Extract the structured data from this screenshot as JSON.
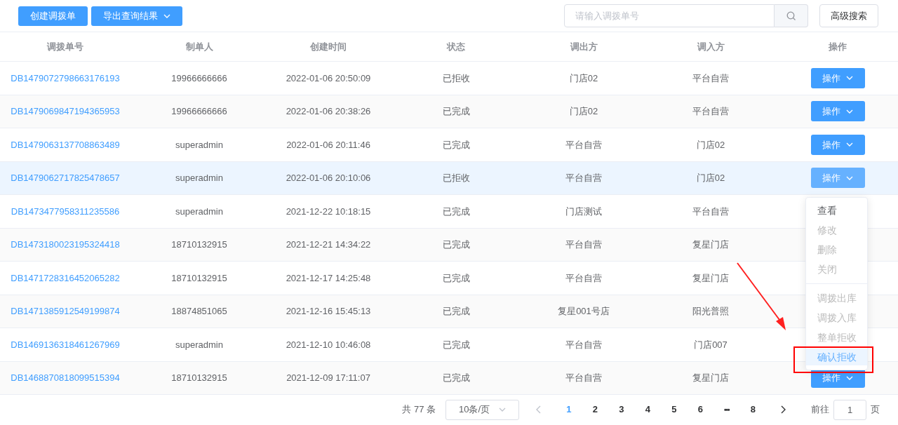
{
  "toolbar": {
    "buttons": [
      {
        "label": "创建调拨单",
        "dropdown": false
      },
      {
        "label": "导出查询结果",
        "dropdown": true
      }
    ],
    "search": {
      "placeholder": "请输入调拨单号"
    },
    "advanced_search": "高级搜索"
  },
  "table": {
    "columns": [
      "调拨单号",
      "制单人",
      "创建时间",
      "状态",
      "调出方",
      "调入方",
      "操作"
    ],
    "rows": [
      {
        "id": "DB1479072798663176193",
        "creator": "19966666666",
        "created": "2022-01-06 20:50:09",
        "status": "已拒收",
        "from": "门店02",
        "to": "平台自营",
        "action": "操作",
        "highlighted": false
      },
      {
        "id": "DB1479069847194365953",
        "creator": "19966666666",
        "created": "2022-01-06 20:38:26",
        "status": "已完成",
        "from": "门店02",
        "to": "平台自营",
        "action": "操作",
        "highlighted": false
      },
      {
        "id": "DB1479063137708863489",
        "creator": "superadmin",
        "created": "2022-01-06 20:11:46",
        "status": "已完成",
        "from": "平台自营",
        "to": "门店02",
        "action": "操作",
        "highlighted": false
      },
      {
        "id": "DB1479062717825478657",
        "creator": "superadmin",
        "created": "2022-01-06 20:10:06",
        "status": "已拒收",
        "from": "平台自营",
        "to": "门店02",
        "action": "操作",
        "highlighted": true
      },
      {
        "id": "DB1473477958311235586",
        "creator": "superadmin",
        "created": "2021-12-22 10:18:15",
        "status": "已完成",
        "from": "门店测试",
        "to": "平台自营",
        "highlighted": false
      },
      {
        "id": "DB1473180023195324418",
        "creator": "18710132915",
        "created": "2021-12-21 14:34:22",
        "status": "已完成",
        "from": "平台自营",
        "to": "复星门店",
        "highlighted": false
      },
      {
        "id": "DB1471728316452065282",
        "creator": "18710132915",
        "created": "2021-12-17 14:25:48",
        "status": "已完成",
        "from": "平台自营",
        "to": "复星门店",
        "highlighted": false
      },
      {
        "id": "DB1471385912549199874",
        "creator": "18874851065",
        "created": "2021-12-16 15:45:13",
        "status": "已完成",
        "from": "复星001号店",
        "to": "阳光普照",
        "highlighted": false
      },
      {
        "id": "DB1469136318461267969",
        "creator": "superadmin",
        "created": "2021-12-10 10:46:08",
        "status": "已完成",
        "from": "平台自营",
        "to": "门店007",
        "highlighted": false
      },
      {
        "id": "DB1468870818099515394",
        "creator": "18710132915",
        "created": "2021-12-09 17:11:07",
        "status": "已完成",
        "from": "平台自营",
        "to": "复星门店",
        "action": "操作",
        "highlighted": false
      }
    ]
  },
  "action_menu": {
    "groups": [
      [
        {
          "label": "查看",
          "disabled": false,
          "selected": false
        },
        {
          "label": "修改",
          "disabled": true,
          "selected": false
        },
        {
          "label": "删除",
          "disabled": true,
          "selected": false
        },
        {
          "label": "关闭",
          "disabled": true,
          "selected": false
        }
      ],
      [
        {
          "label": "调拨出库",
          "disabled": true,
          "selected": false
        },
        {
          "label": "调拨入库",
          "disabled": true,
          "selected": false
        },
        {
          "label": "整单拒收",
          "disabled": true,
          "selected": false
        },
        {
          "label": "确认拒收",
          "disabled": false,
          "selected": true
        }
      ]
    ]
  },
  "pagination": {
    "total": "共 77 条",
    "page_size": "10条/页",
    "pages": [
      {
        "label": "1",
        "kind": "page",
        "selected": true
      },
      {
        "label": "2",
        "kind": "page",
        "selected": false
      },
      {
        "label": "3",
        "kind": "page",
        "selected": false
      },
      {
        "label": "4",
        "kind": "page",
        "selected": false
      },
      {
        "label": "5",
        "kind": "page",
        "selected": false
      },
      {
        "label": "6",
        "kind": "page",
        "selected": false
      },
      {
        "label": "•••",
        "kind": "ellipsis",
        "selected": false
      },
      {
        "label": "8",
        "kind": "page",
        "selected": false
      }
    ],
    "goto_label": "前往",
    "goto_value": "1",
    "goto_suffix": "页"
  }
}
